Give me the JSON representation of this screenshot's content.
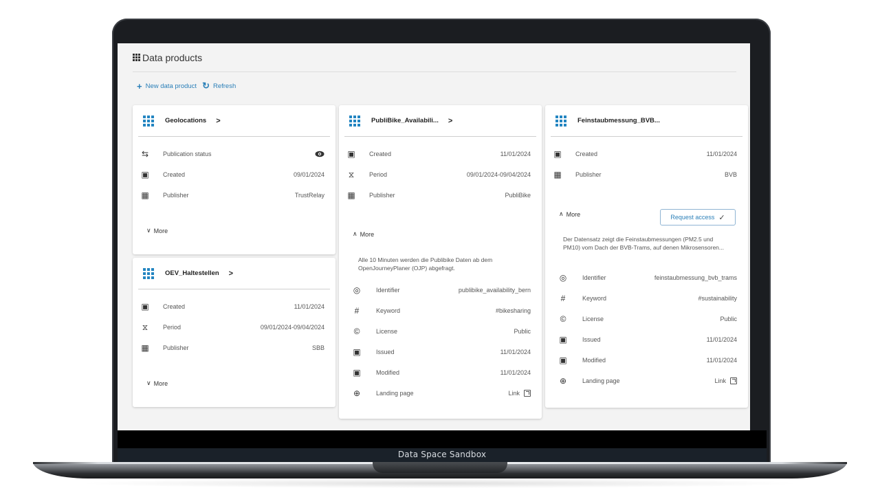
{
  "app": {
    "title": "Data products",
    "footer": "Data Space Sandbox"
  },
  "toolbar": {
    "new_label": "New data product",
    "refresh_label": "Refresh"
  },
  "cards": {
    "geolocations": {
      "title": "Geolocations",
      "rows": {
        "status": {
          "label": "Publication status",
          "icon": "sync-icon"
        },
        "created": {
          "label": "Created",
          "value": "09/01/2024",
          "icon": "calendar-icon"
        },
        "publisher": {
          "label": "Publisher",
          "value": "TrustRelay",
          "icon": "building-icon"
        }
      },
      "more_label": "More"
    },
    "oev": {
      "title": "OEV_Haltestellen",
      "rows": {
        "created": {
          "label": "Created",
          "value": "11/01/2024"
        },
        "period": {
          "label": "Period",
          "value": "09/01/2024-09/04/2024"
        },
        "publisher": {
          "label": "Publisher",
          "value": "SBB"
        }
      },
      "more_label": "More"
    },
    "publibike": {
      "title": "PubliBike_Availabili...",
      "rows": {
        "created": {
          "label": "Created",
          "value": "11/01/2024"
        },
        "period": {
          "label": "Period",
          "value": "09/01/2024-09/04/2024"
        },
        "publisher": {
          "label": "Publisher",
          "value": "PubliBike"
        }
      },
      "more_label": "More",
      "description": "Alle 10 Minuten werden die Publibike Daten ab dem OpenJourneyPlaner (OJP) abgefragt.",
      "details": {
        "identifier": {
          "label": "Identifier",
          "value": "publibike_availability_bern"
        },
        "keyword": {
          "label": "Keyword",
          "value": "#bikesharing"
        },
        "license": {
          "label": "License",
          "value": "Public"
        },
        "issued": {
          "label": "Issued",
          "value": "11/01/2024"
        },
        "modified": {
          "label": "Modified",
          "value": "11/01/2024"
        },
        "landing": {
          "label": "Landing page",
          "value": "Link"
        }
      }
    },
    "feinstaub": {
      "title": "Feinstaubmessung_BVB...",
      "rows": {
        "created": {
          "label": "Created",
          "value": "11/01/2024"
        },
        "publisher": {
          "label": "Publisher",
          "value": "BVB"
        }
      },
      "more_label": "More",
      "request_label": "Request access",
      "description": "Der Datensatz zeigt die Feinstaubmessungen (PM2.5 und PM10) vom Dach der BVB-Trams, auf denen Mikrosensoren...",
      "details": {
        "identifier": {
          "label": "Identifier",
          "value": "feinstaubmessung_bvb_trams"
        },
        "keyword": {
          "label": "Keyword",
          "value": "#sustainability"
        },
        "license": {
          "label": "License",
          "value": "Public"
        },
        "issued": {
          "label": "Issued",
          "value": "11/01/2024"
        },
        "modified": {
          "label": "Modified",
          "value": "11/01/2024"
        },
        "landing": {
          "label": "Landing page",
          "value": "Link"
        }
      }
    }
  },
  "colors": {
    "accent": "#2385c1",
    "link": "#2a7fb8",
    "bezel": "#1b1d21"
  }
}
